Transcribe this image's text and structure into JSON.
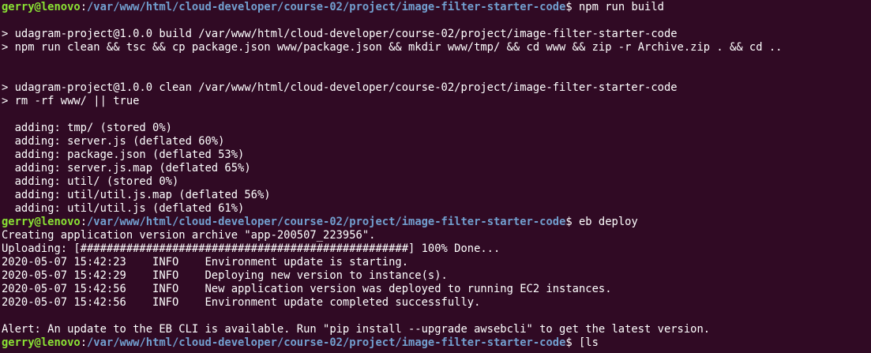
{
  "prompt": {
    "user_host": "gerry@lenovo",
    "separator": ":",
    "path": "/var/www/html/cloud-developer/course-02/project/image-filter-starter-code",
    "symbol": "$"
  },
  "lines": [
    {
      "type": "prompt",
      "command": " npm run build"
    },
    {
      "type": "text",
      "text": ""
    },
    {
      "type": "text",
      "text": "> udagram-project@1.0.0 build /var/www/html/cloud-developer/course-02/project/image-filter-starter-code"
    },
    {
      "type": "text",
      "text": "> npm run clean && tsc && cp package.json www/package.json && mkdir www/tmp/ && cd www && zip -r Archive.zip . && cd .."
    },
    {
      "type": "text",
      "text": ""
    },
    {
      "type": "text",
      "text": ""
    },
    {
      "type": "text",
      "text": "> udagram-project@1.0.0 clean /var/www/html/cloud-developer/course-02/project/image-filter-starter-code"
    },
    {
      "type": "text",
      "text": "> rm -rf www/ || true"
    },
    {
      "type": "text",
      "text": ""
    },
    {
      "type": "text",
      "text": "  adding: tmp/ (stored 0%)"
    },
    {
      "type": "text",
      "text": "  adding: server.js (deflated 60%)"
    },
    {
      "type": "text",
      "text": "  adding: package.json (deflated 53%)"
    },
    {
      "type": "text",
      "text": "  adding: server.js.map (deflated 65%)"
    },
    {
      "type": "text",
      "text": "  adding: util/ (stored 0%)"
    },
    {
      "type": "text",
      "text": "  adding: util/util.js.map (deflated 56%)"
    },
    {
      "type": "text",
      "text": "  adding: util/util.js (deflated 61%)"
    },
    {
      "type": "prompt",
      "command": " eb deploy"
    },
    {
      "type": "text",
      "text": "Creating application version archive \"app-200507_223956\"."
    },
    {
      "type": "text",
      "text": "Uploading: [##################################################] 100% Done..."
    },
    {
      "type": "text",
      "text": "2020-05-07 15:42:23    INFO    Environment update is starting."
    },
    {
      "type": "text",
      "text": "2020-05-07 15:42:29    INFO    Deploying new version to instance(s)."
    },
    {
      "type": "text",
      "text": "2020-05-07 15:42:56    INFO    New application version was deployed to running EC2 instances."
    },
    {
      "type": "text",
      "text": "2020-05-07 15:42:56    INFO    Environment update completed successfully."
    },
    {
      "type": "text",
      "text": ""
    },
    {
      "type": "text",
      "text": "Alert: An update to the EB CLI is available. Run \"pip install --upgrade awsebcli\" to get the latest version."
    },
    {
      "type": "prompt",
      "command": " [ls"
    }
  ],
  "colors": {
    "background": "#300a24",
    "user_host": "#8ae234",
    "path": "#729fcf",
    "text": "#ffffff"
  }
}
